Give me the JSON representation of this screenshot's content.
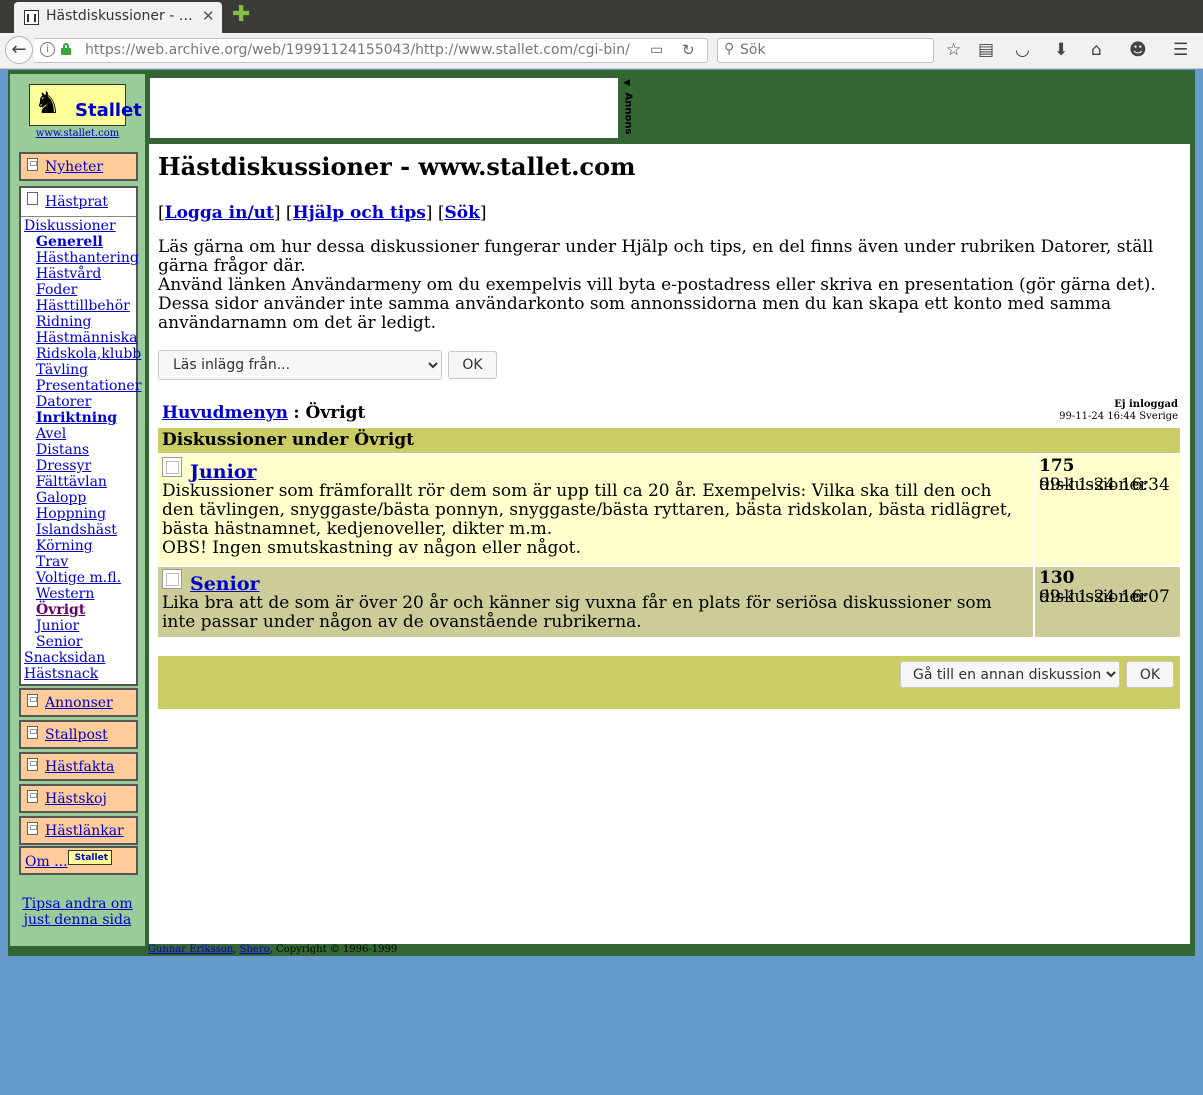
{
  "browser": {
    "tab_title": "Hästdiskussioner - …",
    "url": "https://web.archive.org/web/19991124155043/http://www.stallet.com/cgi-bin/",
    "search_placeholder": "Sök"
  },
  "site": {
    "logo_text": "Stallet",
    "url_text": "www.stallet.com",
    "ad_label": "Annons"
  },
  "menu": {
    "nyheter": "Nyheter",
    "hastprat": "Hästprat",
    "sub_items": [
      {
        "label": "Diskussioner",
        "level": 0
      },
      {
        "label": "Generell",
        "level": 1,
        "bold": true
      },
      {
        "label": "Hästhantering",
        "level": 1
      },
      {
        "label": "Hästvård",
        "level": 1
      },
      {
        "label": "Foder",
        "level": 1
      },
      {
        "label": "Hästtillbehör",
        "level": 1
      },
      {
        "label": "Ridning",
        "level": 1
      },
      {
        "label": "Hästmänniska",
        "level": 1
      },
      {
        "label": "Ridskola,klubb",
        "level": 1
      },
      {
        "label": "Tävling",
        "level": 1
      },
      {
        "label": "Presentationer",
        "level": 1
      },
      {
        "label": "Datorer",
        "level": 1
      },
      {
        "label": "Inriktning",
        "level": 1,
        "bold": true
      },
      {
        "label": "Avel",
        "level": 1
      },
      {
        "label": "Distans",
        "level": 1
      },
      {
        "label": "Dressyr",
        "level": 1
      },
      {
        "label": "Fälttävlan",
        "level": 1
      },
      {
        "label": "Galopp",
        "level": 1
      },
      {
        "label": "Hoppning",
        "level": 1
      },
      {
        "label": "Islandshäst",
        "level": 1
      },
      {
        "label": "Körning",
        "level": 1
      },
      {
        "label": "Trav",
        "level": 1
      },
      {
        "label": "Voltige m.fl.",
        "level": 1
      },
      {
        "label": "Western",
        "level": 1
      },
      {
        "label": "Övrigt",
        "level": 1,
        "bold": true,
        "current": true
      },
      {
        "label": "Junior",
        "level": 1
      },
      {
        "label": "Senior",
        "level": 1
      },
      {
        "label": "Snacksidan",
        "level": 0
      },
      {
        "label": "Hästsnack",
        "level": 0
      }
    ],
    "annonser": "Annonser",
    "stallpost": "Stallpost",
    "hastfakta": "Hästfakta",
    "hastskoj": "Hästskoj",
    "hastlankar": "Hästlänkar",
    "om": "Om ...",
    "om_logo": "Stallet",
    "tipsa": "Tipsa andra om just denna sida"
  },
  "main": {
    "title": "Hästdiskussioner - www.stallet.com",
    "links": {
      "logga": "Logga in/ut",
      "hjalp": "Hjälp och tips",
      "sok": "Sök"
    },
    "intro_1": "Läs gärna om hur dessa diskussioner fungerar under Hjälp och tips, en del finns även under rubriken Datorer, ställ gärna frågor där.",
    "intro_2": "Använd länken Användarmeny om du exempelvis vill byta e-postadress eller skriva en presentation (gör gärna det). Dessa sidor använder inte samma användarkonto som annonssidorna men du kan skapa ett konto med samma användarnamn om det är ledigt.",
    "select_read": "Läs inlägg från...",
    "ok": "OK",
    "breadcrumb_link": "Huvudmenyn",
    "breadcrumb_current": ": Övrigt",
    "login_status": "Ej inloggad",
    "datetime": "99-11-24 16:44 Sverige",
    "table_header": "Diskussioner under Övrigt",
    "rows": [
      {
        "title": "Junior",
        "description_1": "Diskussioner som främforallt rör dem som är upp till ca 20 år. Exempelvis: Vilka ska till den och den tävlingen, snyggaste/bästa ponnyn, snyggaste/bästa ryttaren, bästa ridskolan, bästa ridlägret, bästa hästnamnet, kedjenoveller, dikter m.m.",
        "description_2": "OBS! Ingen smutskastning av någon eller något.",
        "count": "175",
        "count_label": "diskussioner",
        "last": "99-11-24 16:34"
      },
      {
        "title": "Senior",
        "description_1": "Lika bra att de som är över 20 år och känner sig vuxna får en plats för seriösa diskussioner som inte passar under någon av de ovanstående rubrikerna.",
        "description_2": "",
        "count": "130",
        "count_label": "diskussioner",
        "last": "99-11-24 16:07"
      }
    ],
    "select_goto": "Gå till en annan diskussion!",
    "ok2": "OK"
  },
  "footer": {
    "author": "Gunnar Eriksson",
    "company": "Shero",
    "copyright": ", Copyright © 1996-1999"
  },
  "colors": {
    "page_bg": "#6699cc",
    "frame": "#336633",
    "sidebar": "#99cc99",
    "menu_item": "#ffcc99",
    "table_header": "#cccc66",
    "row_junior": "#ffffcc",
    "row_senior": "#cccc99"
  }
}
